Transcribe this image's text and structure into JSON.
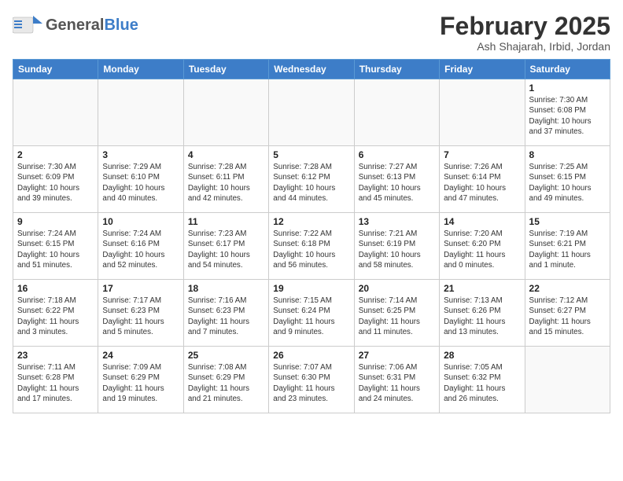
{
  "header": {
    "logo_general": "General",
    "logo_blue": "Blue",
    "title": "February 2025",
    "location": "Ash Shajarah, Irbid, Jordan"
  },
  "days_of_week": [
    "Sunday",
    "Monday",
    "Tuesday",
    "Wednesday",
    "Thursday",
    "Friday",
    "Saturday"
  ],
  "weeks": [
    [
      {
        "day": "",
        "info": ""
      },
      {
        "day": "",
        "info": ""
      },
      {
        "day": "",
        "info": ""
      },
      {
        "day": "",
        "info": ""
      },
      {
        "day": "",
        "info": ""
      },
      {
        "day": "",
        "info": ""
      },
      {
        "day": "1",
        "info": "Sunrise: 7:30 AM\nSunset: 6:08 PM\nDaylight: 10 hours\nand 37 minutes."
      }
    ],
    [
      {
        "day": "2",
        "info": "Sunrise: 7:30 AM\nSunset: 6:09 PM\nDaylight: 10 hours\nand 39 minutes."
      },
      {
        "day": "3",
        "info": "Sunrise: 7:29 AM\nSunset: 6:10 PM\nDaylight: 10 hours\nand 40 minutes."
      },
      {
        "day": "4",
        "info": "Sunrise: 7:28 AM\nSunset: 6:11 PM\nDaylight: 10 hours\nand 42 minutes."
      },
      {
        "day": "5",
        "info": "Sunrise: 7:28 AM\nSunset: 6:12 PM\nDaylight: 10 hours\nand 44 minutes."
      },
      {
        "day": "6",
        "info": "Sunrise: 7:27 AM\nSunset: 6:13 PM\nDaylight: 10 hours\nand 45 minutes."
      },
      {
        "day": "7",
        "info": "Sunrise: 7:26 AM\nSunset: 6:14 PM\nDaylight: 10 hours\nand 47 minutes."
      },
      {
        "day": "8",
        "info": "Sunrise: 7:25 AM\nSunset: 6:15 PM\nDaylight: 10 hours\nand 49 minutes."
      }
    ],
    [
      {
        "day": "9",
        "info": "Sunrise: 7:24 AM\nSunset: 6:15 PM\nDaylight: 10 hours\nand 51 minutes."
      },
      {
        "day": "10",
        "info": "Sunrise: 7:24 AM\nSunset: 6:16 PM\nDaylight: 10 hours\nand 52 minutes."
      },
      {
        "day": "11",
        "info": "Sunrise: 7:23 AM\nSunset: 6:17 PM\nDaylight: 10 hours\nand 54 minutes."
      },
      {
        "day": "12",
        "info": "Sunrise: 7:22 AM\nSunset: 6:18 PM\nDaylight: 10 hours\nand 56 minutes."
      },
      {
        "day": "13",
        "info": "Sunrise: 7:21 AM\nSunset: 6:19 PM\nDaylight: 10 hours\nand 58 minutes."
      },
      {
        "day": "14",
        "info": "Sunrise: 7:20 AM\nSunset: 6:20 PM\nDaylight: 11 hours\nand 0 minutes."
      },
      {
        "day": "15",
        "info": "Sunrise: 7:19 AM\nSunset: 6:21 PM\nDaylight: 11 hours\nand 1 minute."
      }
    ],
    [
      {
        "day": "16",
        "info": "Sunrise: 7:18 AM\nSunset: 6:22 PM\nDaylight: 11 hours\nand 3 minutes."
      },
      {
        "day": "17",
        "info": "Sunrise: 7:17 AM\nSunset: 6:23 PM\nDaylight: 11 hours\nand 5 minutes."
      },
      {
        "day": "18",
        "info": "Sunrise: 7:16 AM\nSunset: 6:23 PM\nDaylight: 11 hours\nand 7 minutes."
      },
      {
        "day": "19",
        "info": "Sunrise: 7:15 AM\nSunset: 6:24 PM\nDaylight: 11 hours\nand 9 minutes."
      },
      {
        "day": "20",
        "info": "Sunrise: 7:14 AM\nSunset: 6:25 PM\nDaylight: 11 hours\nand 11 minutes."
      },
      {
        "day": "21",
        "info": "Sunrise: 7:13 AM\nSunset: 6:26 PM\nDaylight: 11 hours\nand 13 minutes."
      },
      {
        "day": "22",
        "info": "Sunrise: 7:12 AM\nSunset: 6:27 PM\nDaylight: 11 hours\nand 15 minutes."
      }
    ],
    [
      {
        "day": "23",
        "info": "Sunrise: 7:11 AM\nSunset: 6:28 PM\nDaylight: 11 hours\nand 17 minutes."
      },
      {
        "day": "24",
        "info": "Sunrise: 7:09 AM\nSunset: 6:29 PM\nDaylight: 11 hours\nand 19 minutes."
      },
      {
        "day": "25",
        "info": "Sunrise: 7:08 AM\nSunset: 6:29 PM\nDaylight: 11 hours\nand 21 minutes."
      },
      {
        "day": "26",
        "info": "Sunrise: 7:07 AM\nSunset: 6:30 PM\nDaylight: 11 hours\nand 23 minutes."
      },
      {
        "day": "27",
        "info": "Sunrise: 7:06 AM\nSunset: 6:31 PM\nDaylight: 11 hours\nand 24 minutes."
      },
      {
        "day": "28",
        "info": "Sunrise: 7:05 AM\nSunset: 6:32 PM\nDaylight: 11 hours\nand 26 minutes."
      },
      {
        "day": "",
        "info": ""
      }
    ]
  ]
}
